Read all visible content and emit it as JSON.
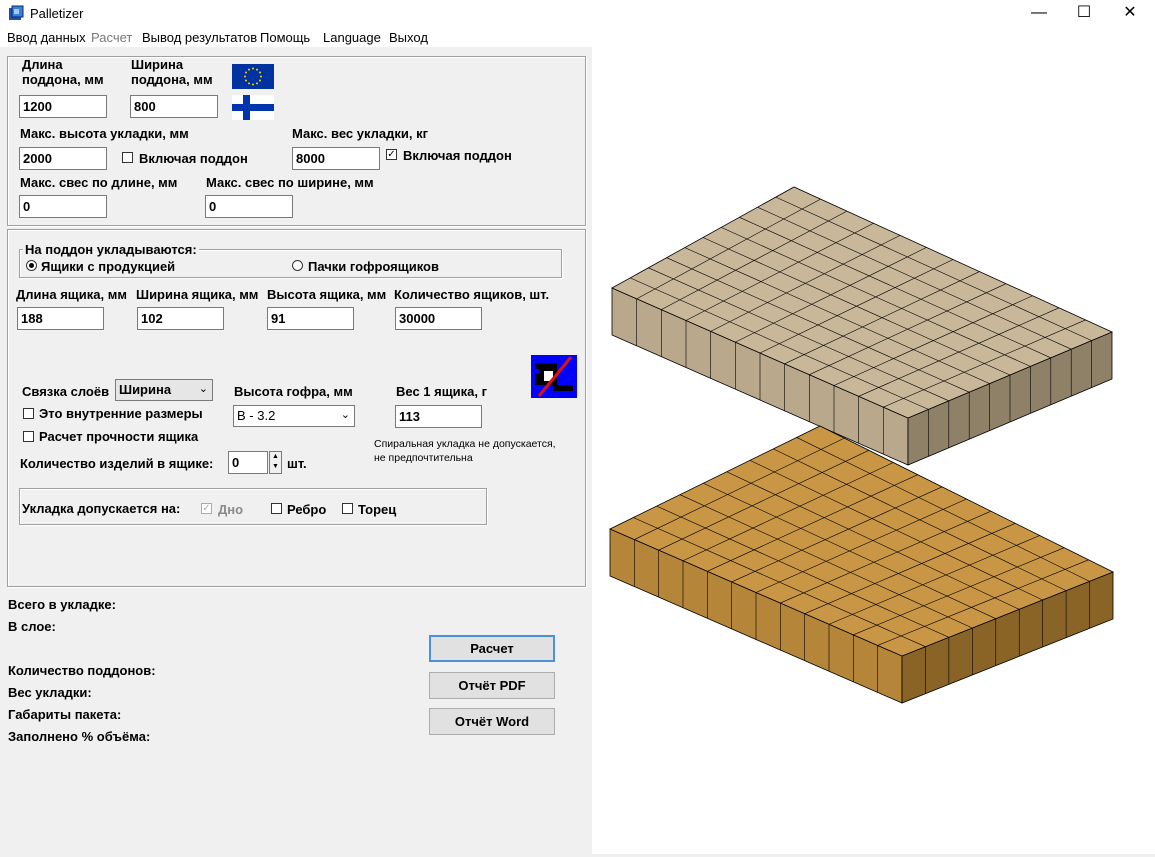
{
  "window": {
    "title": "Palletizer",
    "controls": {
      "minimize": "—",
      "maximize": "☐",
      "close": "✕"
    }
  },
  "menu": [
    {
      "label": "Ввод данных",
      "enabled": true
    },
    {
      "label": "Расчет",
      "enabled": false
    },
    {
      "label": "Вывод результатов",
      "enabled": true
    },
    {
      "label": "Помощь",
      "enabled": true
    },
    {
      "label": "Language",
      "enabled": true
    },
    {
      "label": "Выход",
      "enabled": true
    }
  ],
  "pallet": {
    "length_label": "Длина поддона, мм",
    "length_value": "1200",
    "width_label": "Ширина поддона, мм",
    "width_value": "800",
    "max_height_label": "Макс. высота укладки, мм",
    "max_height_value": "2000",
    "include_pallet_height_label": "Включая поддон",
    "include_pallet_height_checked": false,
    "max_weight_label": "Макс. вес укладки, кг",
    "max_weight_value": "8000",
    "include_pallet_weight_label": "Включая поддон",
    "include_pallet_weight_checked": true,
    "overhang_length_label": "Макс. свес по длине, мм",
    "overhang_length_value": "0",
    "overhang_width_label": "Макс. свес по ширине, мм",
    "overhang_width_value": "0"
  },
  "load": {
    "group_label": "На поддон укладываются:",
    "option_boxes": "Ящики с продукцией",
    "option_bundles": "Пачки гофроящиков",
    "selected": "boxes",
    "box_length_label": "Длина ящика, мм",
    "box_length_value": "188",
    "box_width_label": "Ширина ящика, мм",
    "box_width_value": "102",
    "box_height_label": "Высота ящика, мм",
    "box_height_value": "91",
    "box_count_label": "Количество ящиков, шт.",
    "box_count_value": "30000",
    "layer_tie_label": "Связка слоёв",
    "layer_tie_value": "Ширина",
    "flute_height_label": "Высота гофра, мм",
    "flute_height_value": "B - 3.2",
    "box_weight_label": "Вес 1 ящика, г",
    "box_weight_value": "113",
    "internal_dims_label": "Это внутренние размеры",
    "internal_dims_checked": false,
    "strength_calc_label": "Расчет прочности ящика",
    "strength_calc_checked": false,
    "items_per_box_label": "Количество изделий в ящике:",
    "items_per_box_value": "0",
    "items_unit": "шт.",
    "spiral_note": "Спиральная укладка не допускается, не предпочтительна",
    "orientation_label": "Укладка допускается на:",
    "orientation_bottom": "Дно",
    "orientation_bottom_checked": true,
    "orientation_edge": "Ребро",
    "orientation_edge_checked": false,
    "orientation_end": "Торец",
    "orientation_end_checked": false
  },
  "results": {
    "total": "Всего в укладке:",
    "per_layer": "В слое:",
    "pallet_count": "Количество поддонов:",
    "weight": "Вес укладки:",
    "dimensions": "Габариты пакета:",
    "volume_fill": "Заполнено % объёма:"
  },
  "buttons": {
    "calculate": "Расчет",
    "report_pdf": "Отчёт PDF",
    "report_word": "Отчёт Word"
  },
  "colors": {
    "layer1_top": "#c9b79a",
    "layer1_side_light": "#b9a88c",
    "layer1_side_dark": "#8f8068",
    "layer2_top": "#c89645",
    "layer2_side_light": "#b5863a",
    "layer2_side_dark": "#8a6426"
  }
}
